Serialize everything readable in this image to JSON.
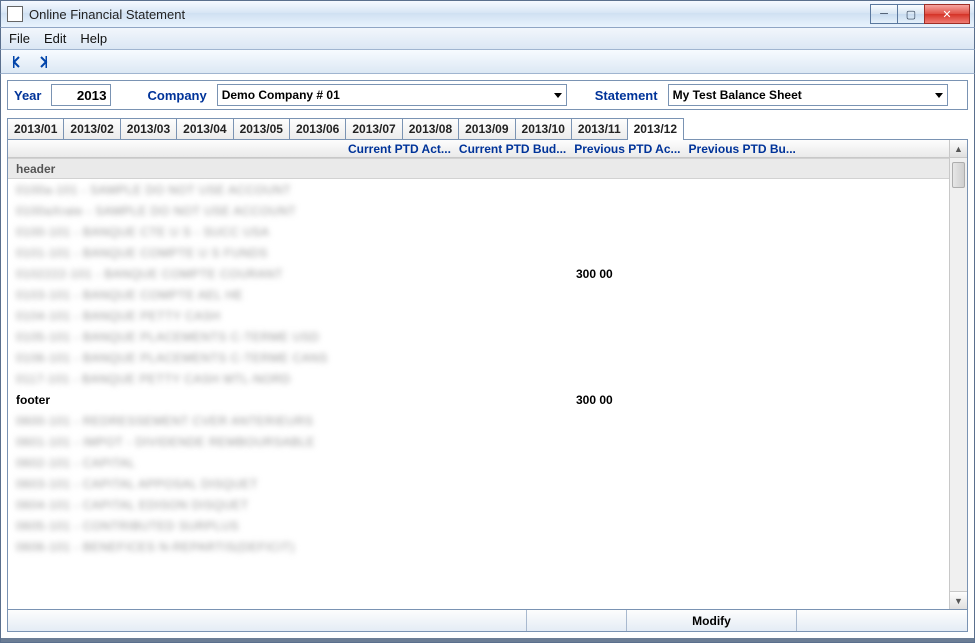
{
  "window": {
    "title": "Online Financial Statement"
  },
  "menu": {
    "file": "File",
    "edit": "Edit",
    "help": "Help"
  },
  "filters": {
    "year_label": "Year",
    "year_value": "2013",
    "company_label": "Company",
    "company_selected": "Demo Company # 01",
    "statement_label": "Statement",
    "statement_selected": "My Test Balance Sheet"
  },
  "tabs": [
    "2013/01",
    "2013/02",
    "2013/03",
    "2013/04",
    "2013/05",
    "2013/06",
    "2013/07",
    "2013/08",
    "2013/09",
    "2013/10",
    "2013/11",
    "2013/12"
  ],
  "tab_active_index": 11,
  "grid": {
    "columns": [
      "Current PTD Act...",
      "Current PTD Bud...",
      "Previous PTD Ac...",
      "Previous PTD Bu..."
    ],
    "section_header": "header",
    "section_footer": "footer",
    "rows_header": [
      {
        "desc": "0100a-101 - SAMPLE DO NOT USE ACCOUNT",
        "val": ""
      },
      {
        "desc": "0100aXrate - SAMPLE DO NOT USE ACCOUNT",
        "val": ""
      },
      {
        "desc": "0100-101 - BANQUE CTE U S - SUCC USA",
        "val": ""
      },
      {
        "desc": "0101-101 - BANQUE COMPTE U S FUNDS",
        "val": ""
      },
      {
        "desc": "0102222-101 - BANQUE COMPTE COURANT",
        "val": "300 00"
      },
      {
        "desc": "0103-101 - BANQUE COMPTE AEL HE",
        "val": ""
      },
      {
        "desc": "0104-101 - BANQUE PETTY CASH",
        "val": ""
      },
      {
        "desc": "0105-101 - BANQUE PLACEMENTS C-TERME USD",
        "val": ""
      },
      {
        "desc": "0106-101 - BANQUE PLACEMENTS C-TERME CANS",
        "val": ""
      },
      {
        "desc": "0117-101 - BANQUE PETTY CASH MTL-NORD",
        "val": ""
      }
    ],
    "footer_total": "300 00",
    "rows_footer": [
      {
        "desc": "0600-101 - REDRESSEMENT CVER ANTERIEURS",
        "val": ""
      },
      {
        "desc": "0601-101 - IMPOT - DIVIDENDE REMBOURSABLE",
        "val": ""
      },
      {
        "desc": "0602-101 - CAPITAL",
        "val": ""
      },
      {
        "desc": "0603-101 - CAPITAL APPOSAL DISQUET",
        "val": ""
      },
      {
        "desc": "0604-101 - CAPITAL EDISON DISQUET",
        "val": ""
      },
      {
        "desc": "0605-101 - CONTRIBUTED SURPLUS",
        "val": ""
      },
      {
        "desc": "0606-101 - BENEFICES N-REPARTIS(DEFICIT)",
        "val": ""
      }
    ]
  },
  "statusbar": {
    "modify": "Modify"
  }
}
